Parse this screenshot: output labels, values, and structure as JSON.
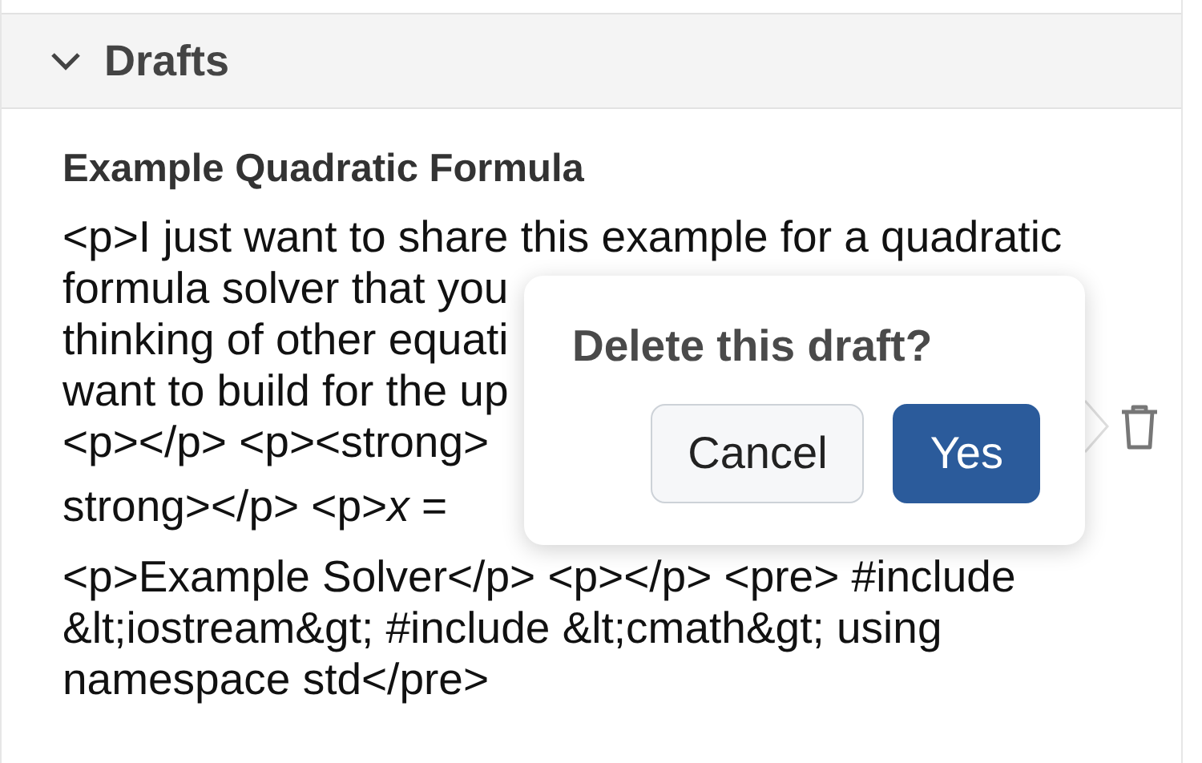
{
  "section": {
    "title": "Drafts",
    "expanded": true
  },
  "draft": {
    "title": "Example Quadratic Formula",
    "lines": [
      "<p>I just want to share this example for a quadratic",
      "formula solver that you",
      "thinking of other equati",
      "want to build for the up",
      "<p></p> <p><strong>",
      "strong></p> <p>*x* =",
      "<p>Example Solver</p> <p></p> <pre> #include",
      "&lt;iostream&gt; #include &lt;cmath&gt; using",
      "namespace std</pre>"
    ]
  },
  "confirm": {
    "question": "Delete this draft?",
    "buttons": [
      {
        "label": "Cancel",
        "kind": "secondary"
      },
      {
        "label": "Yes",
        "kind": "primary"
      }
    ]
  }
}
